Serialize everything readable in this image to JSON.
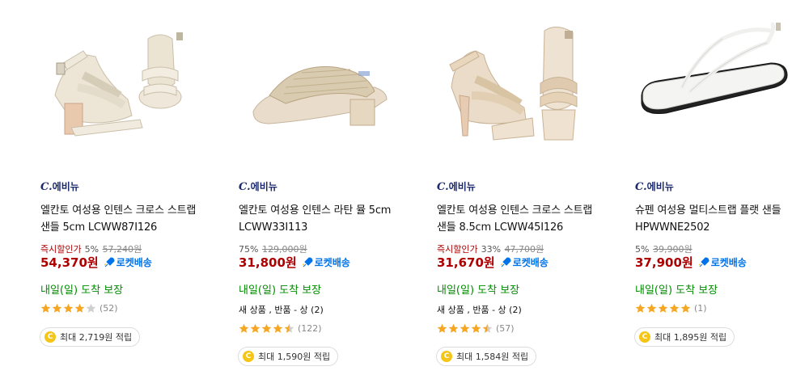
{
  "products": [
    {
      "brand_mark": "C.",
      "brand_name": "에비뉴",
      "name": "엘칸토 여성용 인텐스 크로스 스트랩 샌들 5cm LCWW87I126",
      "instant_label": "즉시할인가",
      "discount": "5%",
      "original_price": "57,240원",
      "price": "54,370원",
      "rocket_label": "로켓배송",
      "delivery": "내일(일) 도착 보장",
      "condition": "",
      "rating_stars": 4,
      "review_count": "(52)",
      "cashback": "최대 2,719원 적립",
      "coin_symbol": "C",
      "image_icon": "cream-cross-strap-block-heel-sandal"
    },
    {
      "brand_mark": "C.",
      "brand_name": "에비뉴",
      "name": "엘칸토 여성용 인텐스 라탄 뮬 5cm LCWW33I113",
      "instant_label": "",
      "discount": "75%",
      "original_price": "129,000원",
      "price": "31,800원",
      "rocket_label": "로켓배송",
      "delivery": "내일(일) 도착 보장",
      "condition": "새 상품 , 반품 - 상 (2)",
      "rating_stars": 4.5,
      "review_count": "(122)",
      "cashback": "최대 1,590원 적립",
      "coin_symbol": "C",
      "image_icon": "rattan-block-heel-mule"
    },
    {
      "brand_mark": "C.",
      "brand_name": "에비뉴",
      "name": "엘칸토 여성용 인텐스 크로스 스트랩 샌들 8.5cm LCWW45I126",
      "instant_label": "즉시할인가",
      "discount": "33%",
      "original_price": "47,700원",
      "price": "31,670원",
      "rocket_label": "로켓배송",
      "delivery": "내일(일) 도착 보장",
      "condition": "새 상품 , 반품 - 상 (2)",
      "rating_stars": 4.5,
      "review_count": "(57)",
      "cashback": "최대 1,584원 적립",
      "coin_symbol": "C",
      "image_icon": "beige-cross-strap-platform-heel-sandal"
    },
    {
      "brand_mark": "C.",
      "brand_name": "에비뉴",
      "name": "슈펜 여성용 멀티스트랩 플랫 샌들 HPWWNE2502",
      "instant_label": "",
      "discount": "5%",
      "original_price": "39,900원",
      "price": "37,900원",
      "rocket_label": "로켓배송",
      "delivery": "내일(일) 도착 보장",
      "condition": "",
      "rating_stars": 5,
      "review_count": "(1)",
      "cashback": "최대 1,895원 적립",
      "coin_symbol": "C",
      "image_icon": "white-multi-strap-flat-sandal"
    }
  ],
  "colors": {
    "price": "#ae0000",
    "rocket": "#0073e9",
    "delivery": "#008c00",
    "star": "#f5a623",
    "star_empty": "#d0d0d0",
    "coin": "#f5c518",
    "brand": "#1c2a6e"
  }
}
